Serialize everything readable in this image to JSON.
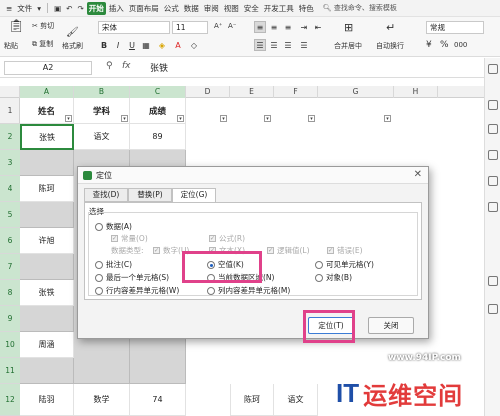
{
  "menubar": {
    "file": "文件",
    "items": [
      "开始",
      "插入",
      "页面布局",
      "公式",
      "数据",
      "审阅",
      "视图",
      "安全",
      "开发工具",
      "特色"
    ],
    "search": "查找命令、搜索模板"
  },
  "ribbon": {
    "paste": "粘贴",
    "cut": "剪切",
    "copy": "复制",
    "format_painter": "格式刷",
    "font_name": "宋体",
    "font_size": "11",
    "bold": "B",
    "italic": "I",
    "underline": "U",
    "font_grow": "A⁺",
    "font_shrink": "A⁻",
    "merge": "合并居中",
    "wrap": "自动换行",
    "number_format": "常规",
    "currency": "¥",
    "percent": "%",
    "thousands": "000"
  },
  "formula_bar": {
    "name_box": "A2",
    "fx": "fx",
    "content": "张铁"
  },
  "columns": [
    "A",
    "B",
    "C",
    "D",
    "E",
    "F",
    "G",
    "H"
  ],
  "rows": [
    "1",
    "2",
    "3",
    "4",
    "5",
    "6",
    "7",
    "8",
    "9",
    "10",
    "11",
    "12"
  ],
  "table": {
    "headers": [
      "姓名",
      "学科",
      "成绩"
    ],
    "cells": [
      {
        "row": "2",
        "name": "张铁",
        "subject": "语文",
        "score": "89"
      },
      {
        "row": "4",
        "name": "陈珂",
        "subject": "",
        "score": ""
      },
      {
        "row": "6",
        "name": "许旭",
        "subject": "",
        "score": ""
      },
      {
        "row": "8",
        "name": "张铁",
        "subject": "",
        "score": ""
      },
      {
        "row": "10",
        "name": "周涵",
        "subject": "",
        "score": ""
      },
      {
        "row": "12",
        "name": "陆羽",
        "subject": "数学",
        "score": "74"
      }
    ],
    "extra": {
      "e12": "陈珂",
      "f12": "语文"
    }
  },
  "dialog": {
    "title": "定位",
    "close": "✕",
    "tabs": [
      "查找(D)",
      "替换(P)",
      "定位(G)"
    ],
    "active_tab": "定位(G)",
    "group_label": "选择",
    "options": {
      "data": "数据(A)",
      "constant": "常量(O)",
      "formula": "公式(R)",
      "data_type": "数据类型:",
      "number": "数字(U)",
      "text": "文本(X)",
      "logical": "逻辑值(L)",
      "error": "错误(E)",
      "comment": "批注(C)",
      "blank": "空值(K)",
      "visible": "可见单元格(Y)",
      "last_cell": "最后一个单元格(S)",
      "current_array": "当前数据区域(N)",
      "objects": "对象(B)",
      "row_diff": "行内容差异单元格(W)",
      "col_diff": "列内容差异单元格(M)"
    },
    "selected_option": "空值(K)",
    "locate_button": "定位(T)",
    "close_button": "关闭"
  },
  "watermark": {
    "url": "www.94IP.com",
    "brand_latin": "IT",
    "brand_cn": "运维空间"
  },
  "colors": {
    "accent": "#2c8a3d",
    "highlight": "#e0418a",
    "gray_cell": "#d6d6d6",
    "brand_blue": "#1f4fa8",
    "brand_red": "#e23b3b"
  }
}
